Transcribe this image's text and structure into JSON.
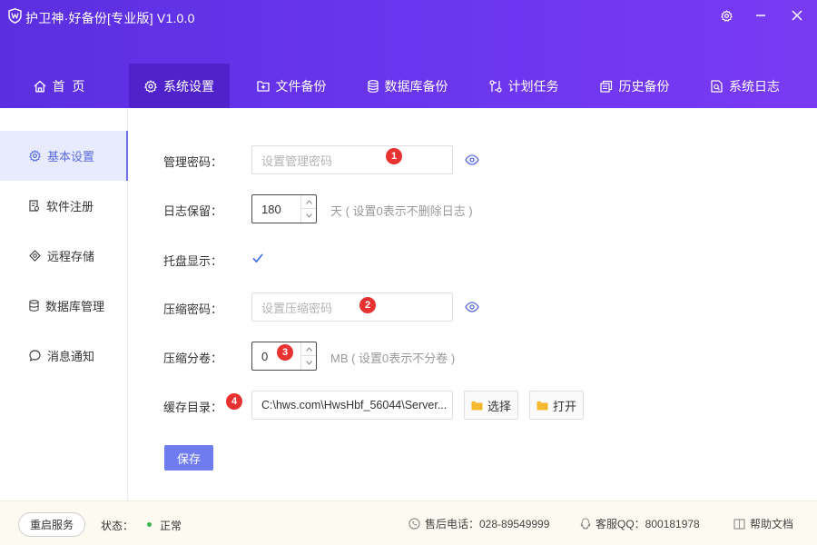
{
  "app": {
    "title": "护卫神·好备份[专业版]  V1.0.0"
  },
  "nav": {
    "items": [
      {
        "label": "首  页",
        "icon": "home-icon"
      },
      {
        "label": "系统设置",
        "icon": "gear-icon",
        "active": true
      },
      {
        "label": "文件备份",
        "icon": "folder-plus-icon"
      },
      {
        "label": "数据库备份",
        "icon": "database-icon"
      },
      {
        "label": "计划任务",
        "icon": "schedule-icon"
      },
      {
        "label": "历史备份",
        "icon": "history-icon"
      },
      {
        "label": "系统日志",
        "icon": "log-icon"
      }
    ]
  },
  "sidebar": {
    "items": [
      {
        "label": "基本设置",
        "icon": "gear-icon",
        "active": true
      },
      {
        "label": "软件注册",
        "icon": "register-icon"
      },
      {
        "label": "远程存储",
        "icon": "remote-storage-icon"
      },
      {
        "label": "数据库管理",
        "icon": "database-icon"
      },
      {
        "label": "消息通知",
        "icon": "chat-icon"
      }
    ]
  },
  "form": {
    "admin_password": {
      "label": "管理密码：",
      "placeholder": "设置管理密码",
      "badge": "1"
    },
    "log_retention": {
      "label": "日志保留：",
      "value": "180",
      "hint": "天 ( 设置0表示不删除日志 )"
    },
    "tray_display": {
      "label": "托盘显示：",
      "checked": true
    },
    "compress_password": {
      "label": "压缩密码：",
      "placeholder": "设置压缩密码",
      "badge": "2"
    },
    "split_volume": {
      "label": "压缩分卷：",
      "value": "0",
      "hint": "MB ( 设置0表示不分卷 )",
      "badge": "3"
    },
    "cache_dir": {
      "label": "缓存目录：",
      "value": "C:\\hws.com\\HwsHbf_56044\\Server...",
      "badge": "4",
      "choose_label": "选择",
      "open_label": "打开"
    },
    "save_label": "保存"
  },
  "footer": {
    "restart_label": "重启服务",
    "status_label": "状态：",
    "status_value": "正常",
    "phone": "售后电话：028-89549999",
    "qq": "客服QQ：800181978",
    "help": "帮助文档"
  },
  "colors": {
    "header_start": "#5b2fe0",
    "header_end": "#7a3af4",
    "nav_active": "#4f22cc",
    "accent": "#6f7cf0",
    "badge": "#e83232",
    "status_ok": "#3bb54a"
  }
}
